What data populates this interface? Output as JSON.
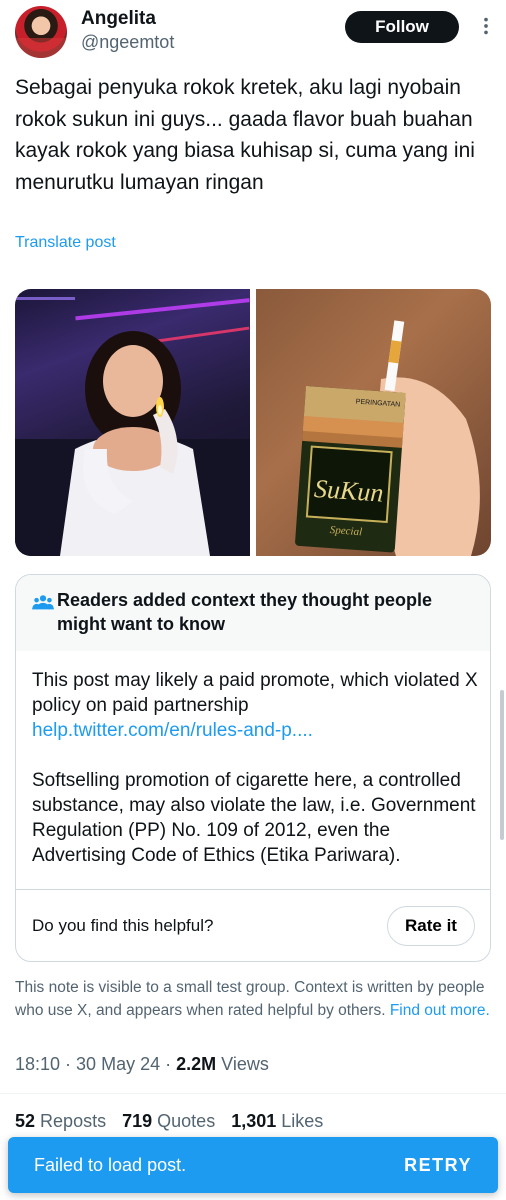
{
  "author": {
    "display_name": "Angelita",
    "handle": "@ngeemtot",
    "follow_label": "Follow"
  },
  "post": {
    "text": "Sebagai penyuka rokok kretek, aku lagi nyobain rokok sukun ini guys... gaada flavor buah buahan kayak rokok yang biasa kuhisap si, cuma yang ini menurutku lumayan ringan",
    "translate_label": "Translate post"
  },
  "community_note": {
    "title": "Readers added context they thought people might want to know",
    "paragraph1": "This post may likely a paid promote, which violated X policy on paid partnership",
    "link": "help.twitter.com/en/rules-and-p....",
    "paragraph2": "Softselling promotion of cigarette here, a controlled substance, may also violate the law, i.e. Government Regulation (PP) No. 109 of 2012, even the Advertising Code of Ethics (Etika Pariwara).",
    "helpful_prompt": "Do you find this helpful?",
    "rate_label": "Rate it"
  },
  "note_footer": {
    "text": "This note is visible to a small test group. Context is written by people who use X, and appears when rated helpful by others.",
    "link": "Find out more."
  },
  "meta": {
    "time": "18:10",
    "dot1": " · ",
    "date": "30 May 24",
    "dot2": " · ",
    "views_count": "2.2M",
    "views_label": "Views"
  },
  "stats": {
    "reposts_count": "52",
    "reposts_label": "Reposts",
    "quotes_count": "719",
    "quotes_label": "Quotes",
    "likes_count": "1,301",
    "likes_label": "Likes"
  },
  "toast": {
    "message": "Failed to load post.",
    "action": "RETRY"
  },
  "colors": {
    "accent": "#1d9bf0",
    "text": "#0f1419",
    "muted": "#536471"
  },
  "packaging_text": {
    "brand": "SuKun",
    "variant": "Special",
    "warning": "PERINGATAN"
  }
}
